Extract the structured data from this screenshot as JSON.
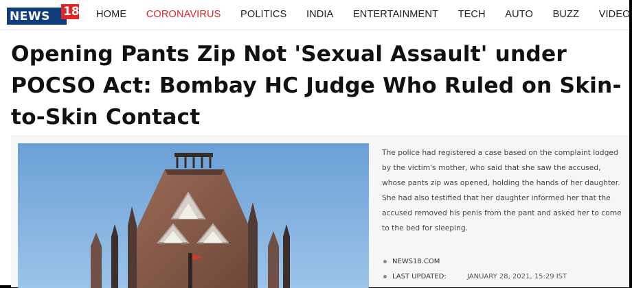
{
  "brand": {
    "name": "NEWS",
    "number": "18",
    "primary_color": "#0f3d7d",
    "badge_color": "#e32526"
  },
  "nav": {
    "active_color": "#e32526",
    "items": [
      "HOME",
      "CORONAVIRUS",
      "POLITICS",
      "INDIA",
      "ENTERTAINMENT",
      "TECH",
      "AUTO",
      "BUZZ",
      "VIDEOS"
    ],
    "active_item": "CORONAVIRUS"
  },
  "article": {
    "headline": "Opening Pants Zip Not 'Sexual Assault' under POCSO Act: Bombay HC Judge Who Ruled on Skin-to-Skin Contact",
    "body": "The police had registered a case based on the complaint lodged by the victim's mother, who said that she saw the accused, whose pants zip was opened, holding the hands of her daughter. She had also testified that her daughter informed her that the accused removed his penis from the pant and asked her to come to the bed for sleeping.",
    "source": "NEWS18.COM",
    "updated_label": "LAST UPDATED:",
    "updated_value": "JANUARY 28, 2021, 15:29 IST",
    "image_icon": "bombay-high-court-building"
  }
}
